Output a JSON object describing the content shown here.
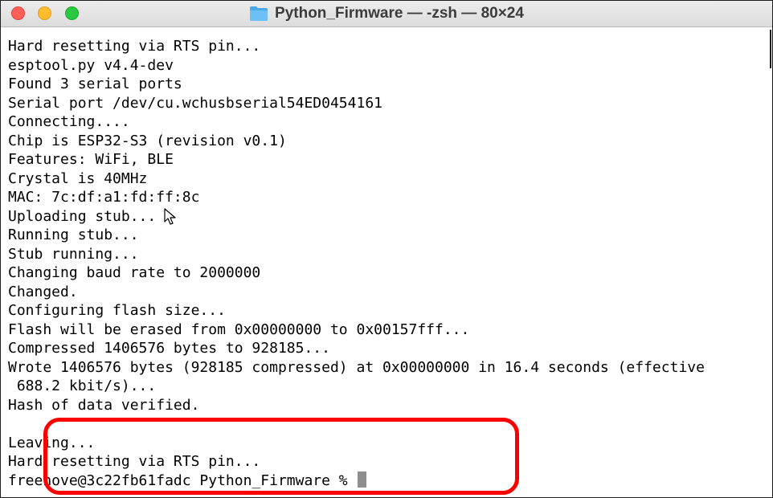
{
  "window": {
    "title": "Python_Firmware — -zsh — 80×24",
    "title_icon": "folder-icon",
    "traffic_lights": {
      "close_color": "#fe5f57",
      "minimize_color": "#febc2e",
      "zoom_color": "#28c840"
    }
  },
  "terminal": {
    "lines": [
      "Hard resetting via RTS pin...",
      "esptool.py v4.4-dev",
      "Found 3 serial ports",
      "Serial port /dev/cu.wchusbserial54ED0454161",
      "Connecting....",
      "Chip is ESP32-S3 (revision v0.1)",
      "Features: WiFi, BLE",
      "Crystal is 40MHz",
      "MAC: 7c:df:a1:fd:ff:8c",
      "Uploading stub...",
      "Running stub...",
      "Stub running...",
      "Changing baud rate to 2000000",
      "Changed.",
      "Configuring flash size...",
      "Flash will be erased from 0x00000000 to 0x00157fff...",
      "Compressed 1406576 bytes to 928185...",
      "Wrote 1406576 bytes (928185 compressed) at 0x00000000 in 16.4 seconds (effective",
      " 688.2 kbit/s)...",
      "Hash of data verified.",
      "",
      "Leaving...",
      "Hard resetting via RTS pin..."
    ],
    "prompt": "freenove@3c22fb61fadc Python_Firmware % ",
    "background_color": "#ffffff",
    "text_color": "#000000",
    "cursor_color": "#8f8f8f"
  },
  "annotation": {
    "highlight_color": "#ff0000"
  }
}
